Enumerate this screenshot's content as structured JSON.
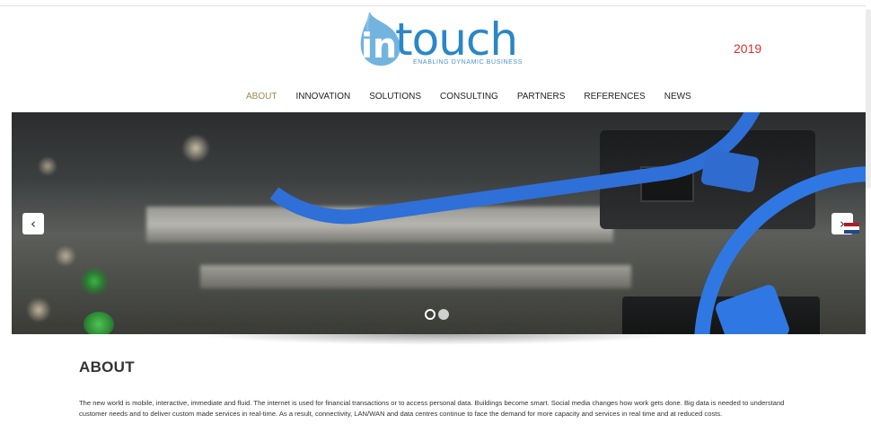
{
  "header": {
    "logo_word": "touch",
    "logo_prefix": "in",
    "tagline": "ENABLING DYNAMIC BUSINESS",
    "year": "2019"
  },
  "nav": {
    "items": [
      {
        "label": "ABOUT",
        "active": true
      },
      {
        "label": "INNOVATION",
        "active": false
      },
      {
        "label": "SOLUTIONS",
        "active": false
      },
      {
        "label": "CONSULTING",
        "active": false
      },
      {
        "label": "PARTNERS",
        "active": false
      },
      {
        "label": "REFERENCES",
        "active": false
      },
      {
        "label": "NEWS",
        "active": false
      }
    ]
  },
  "slider": {
    "prev_symbol": "‹",
    "next_symbol": "›",
    "slide_count": 2,
    "active_index": 0,
    "language_flag": "netherlands-flag",
    "flag_colors": [
      "#ae1c28",
      "#ffffff",
      "#21468b"
    ]
  },
  "about": {
    "title": "ABOUT",
    "text": "The new world is mobile, interactive, immediate and fluid. The internet is used for financial transactions or to access personal data. Buildings become smart. Social media changes how work gets done. Big data is needed to understand customer needs and to deliver custom made services in real-time. As a result, connectivity, LAN/WAN and data centres continue to face the demand for more capacity and services in real time and at reduced costs."
  },
  "colors": {
    "brand_blue": "#2a87c7",
    "nav_active": "#9a8a4c",
    "year_red": "#d9302c"
  }
}
